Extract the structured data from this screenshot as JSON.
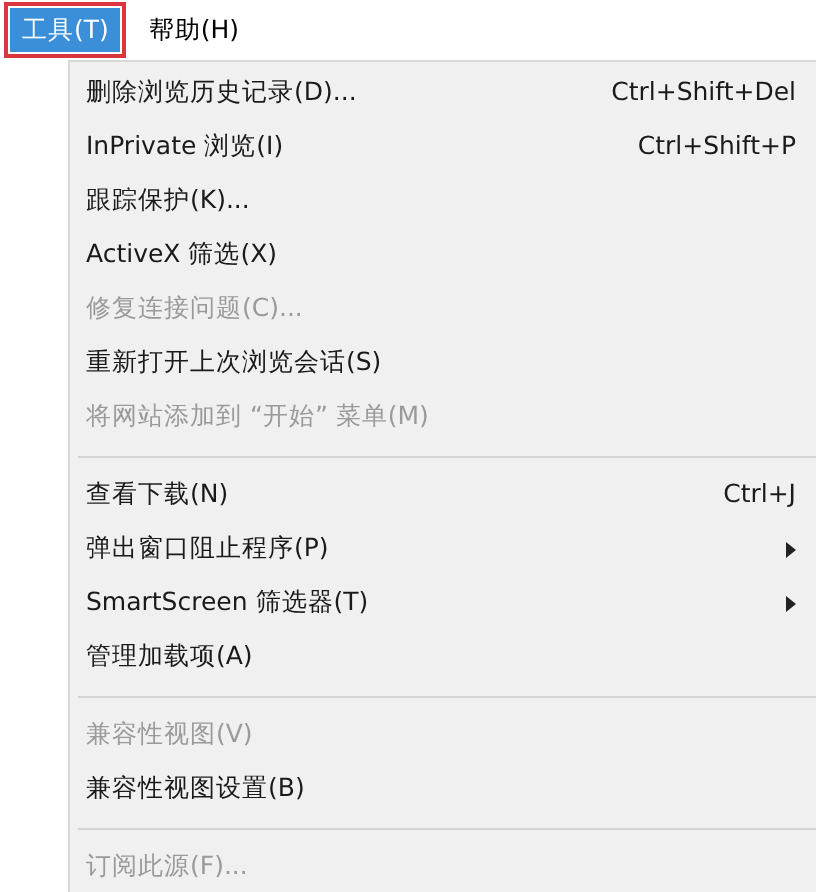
{
  "menu_bar": [
    {
      "label": "工具(T)",
      "selected": true,
      "highlighted": true
    },
    {
      "label": "帮助(H)",
      "selected": false,
      "highlighted": false
    }
  ],
  "menu": [
    {
      "kind": "item",
      "label": "删除浏览历史记录(D)...",
      "shortcut": "Ctrl+Shift+Del",
      "disabled": false,
      "submenu": false
    },
    {
      "kind": "item",
      "label": "InPrivate 浏览(I)",
      "shortcut": "Ctrl+Shift+P",
      "disabled": false,
      "submenu": false
    },
    {
      "kind": "item",
      "label": "跟踪保护(K)...",
      "disabled": false,
      "submenu": false
    },
    {
      "kind": "item",
      "label": "ActiveX 筛选(X)",
      "disabled": false,
      "submenu": false
    },
    {
      "kind": "item",
      "label": "修复连接问题(C)...",
      "disabled": true,
      "submenu": false
    },
    {
      "kind": "item",
      "label": "重新打开上次浏览会话(S)",
      "disabled": false,
      "submenu": false
    },
    {
      "kind": "item",
      "label": "将网站添加到 “开始” 菜单(M)",
      "disabled": true,
      "submenu": false
    },
    {
      "kind": "separator"
    },
    {
      "kind": "item",
      "label": "查看下载(N)",
      "shortcut": "Ctrl+J",
      "disabled": false,
      "submenu": false
    },
    {
      "kind": "item",
      "label": "弹出窗口阻止程序(P)",
      "disabled": false,
      "submenu": true
    },
    {
      "kind": "item",
      "label": "SmartScreen 筛选器(T)",
      "disabled": false,
      "submenu": true
    },
    {
      "kind": "item",
      "label": "管理加载项(A)",
      "disabled": false,
      "submenu": false
    },
    {
      "kind": "separator"
    },
    {
      "kind": "item",
      "label": "兼容性视图(V)",
      "disabled": true,
      "submenu": false
    },
    {
      "kind": "item",
      "label": "兼容性视图设置(B)",
      "disabled": false,
      "submenu": false
    },
    {
      "kind": "separator"
    },
    {
      "kind": "item",
      "label": "订阅此源(F)...",
      "disabled": true,
      "submenu": false
    }
  ]
}
